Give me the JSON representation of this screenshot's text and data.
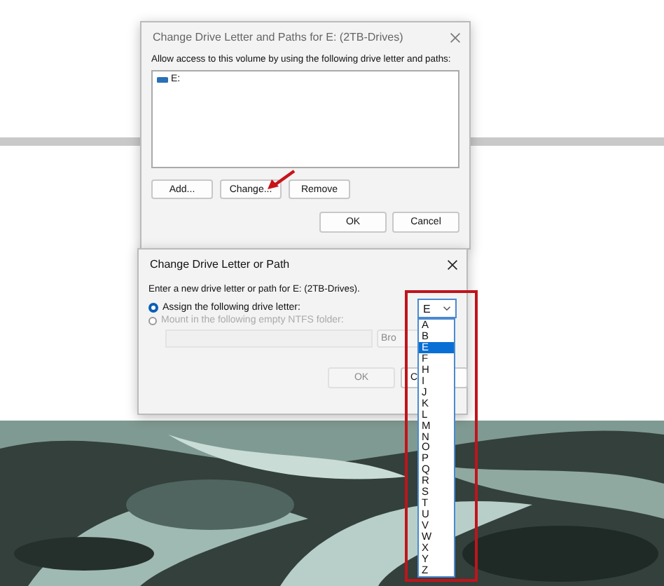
{
  "dialog_main": {
    "title": "Change Drive Letter and Paths for E: (2TB-Drives)",
    "instruction": "Allow access to this volume by using the following drive letter and paths:",
    "paths": [
      {
        "label": "E:",
        "selected": false
      }
    ],
    "buttons": [
      {
        "label": "Add..."
      },
      {
        "label": "Change..."
      },
      {
        "label": "Remove"
      }
    ],
    "footer_buttons": [
      "OK",
      "Cancel"
    ]
  },
  "dialog_change": {
    "title": "Change Drive Letter or Path",
    "instruction": "Enter a new drive letter or path for E: (2TB-Drives).",
    "options": [
      {
        "label": "Assign the following drive letter:",
        "selected": true,
        "disabled": false
      },
      {
        "label": "Mount in the following empty NTFS folder:",
        "selected": false,
        "disabled": true
      }
    ],
    "browse_button": {
      "label": "Bro",
      "disabled": true
    },
    "ok_button": {
      "label": "OK",
      "disabled": true
    },
    "cancel_button": {
      "label": "C",
      "disabled": false
    }
  },
  "drive_letter": {
    "value": "E",
    "expanded": true,
    "options": [
      {
        "label": "A",
        "selected": false
      },
      {
        "label": "B",
        "selected": false
      },
      {
        "label": "E",
        "selected": true
      },
      {
        "label": "F",
        "selected": false
      },
      {
        "label": "H",
        "selected": false
      },
      {
        "label": "I",
        "selected": false
      },
      {
        "label": "J",
        "selected": false
      },
      {
        "label": "K",
        "selected": false
      },
      {
        "label": "L",
        "selected": false
      },
      {
        "label": "M",
        "selected": false
      },
      {
        "label": "N",
        "selected": false
      },
      {
        "label": "O",
        "selected": false
      },
      {
        "label": "P",
        "selected": false
      },
      {
        "label": "Q",
        "selected": false
      },
      {
        "label": "R",
        "selected": false
      },
      {
        "label": "S",
        "selected": false
      },
      {
        "label": "T",
        "selected": false
      },
      {
        "label": "U",
        "selected": false
      },
      {
        "label": "V",
        "selected": false
      },
      {
        "label": "W",
        "selected": false
      },
      {
        "label": "X",
        "selected": false
      },
      {
        "label": "Y",
        "selected": false
      },
      {
        "label": "Z",
        "selected": false
      }
    ]
  }
}
